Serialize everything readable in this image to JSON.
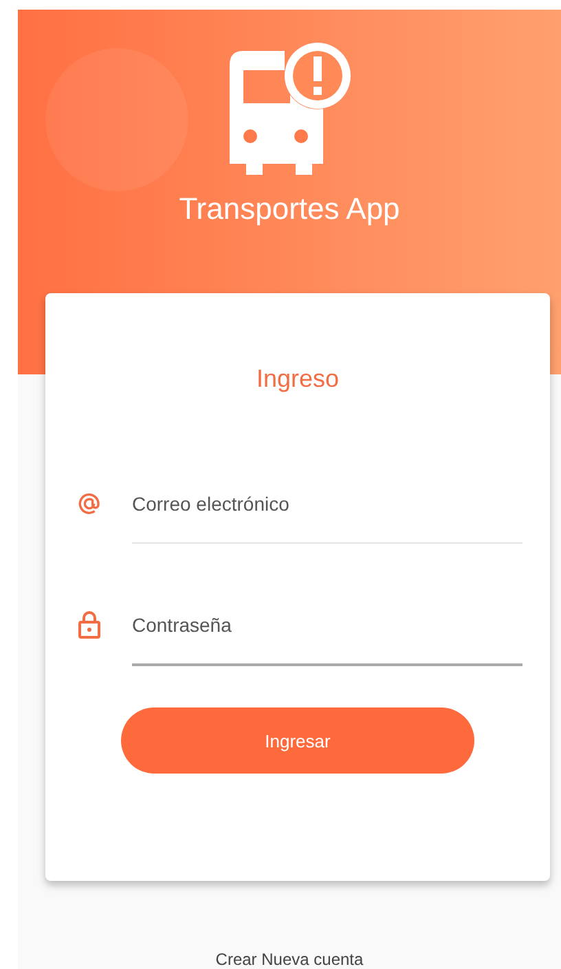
{
  "header": {
    "title": "Transportes App"
  },
  "login_card": {
    "heading": "Ingreso",
    "fields": [
      {
        "kind": "email",
        "placeholder": "Correo electrónico",
        "focused": false
      },
      {
        "kind": "password",
        "placeholder": "Contraseña",
        "focused": true
      }
    ],
    "submit_button": "Ingresar"
  },
  "footer_link": "Crear Nueva cuenta"
}
